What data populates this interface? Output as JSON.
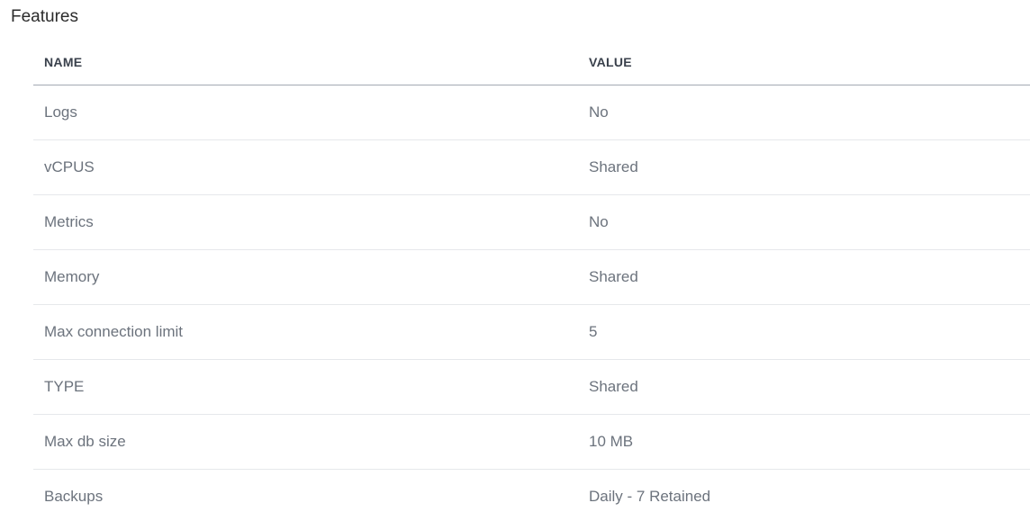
{
  "section": {
    "title": "Features"
  },
  "table": {
    "headers": {
      "name": "NAME",
      "value": "VALUE"
    },
    "rows": [
      {
        "name": "Logs",
        "value": "No"
      },
      {
        "name": "vCPUS",
        "value": "Shared"
      },
      {
        "name": "Metrics",
        "value": "No"
      },
      {
        "name": "Memory",
        "value": "Shared"
      },
      {
        "name": "Max connection limit",
        "value": "5"
      },
      {
        "name": "TYPE",
        "value": "Shared"
      },
      {
        "name": "Max db size",
        "value": "10 MB"
      },
      {
        "name": "Backups",
        "value": "Daily - 7 Retained"
      }
    ]
  }
}
